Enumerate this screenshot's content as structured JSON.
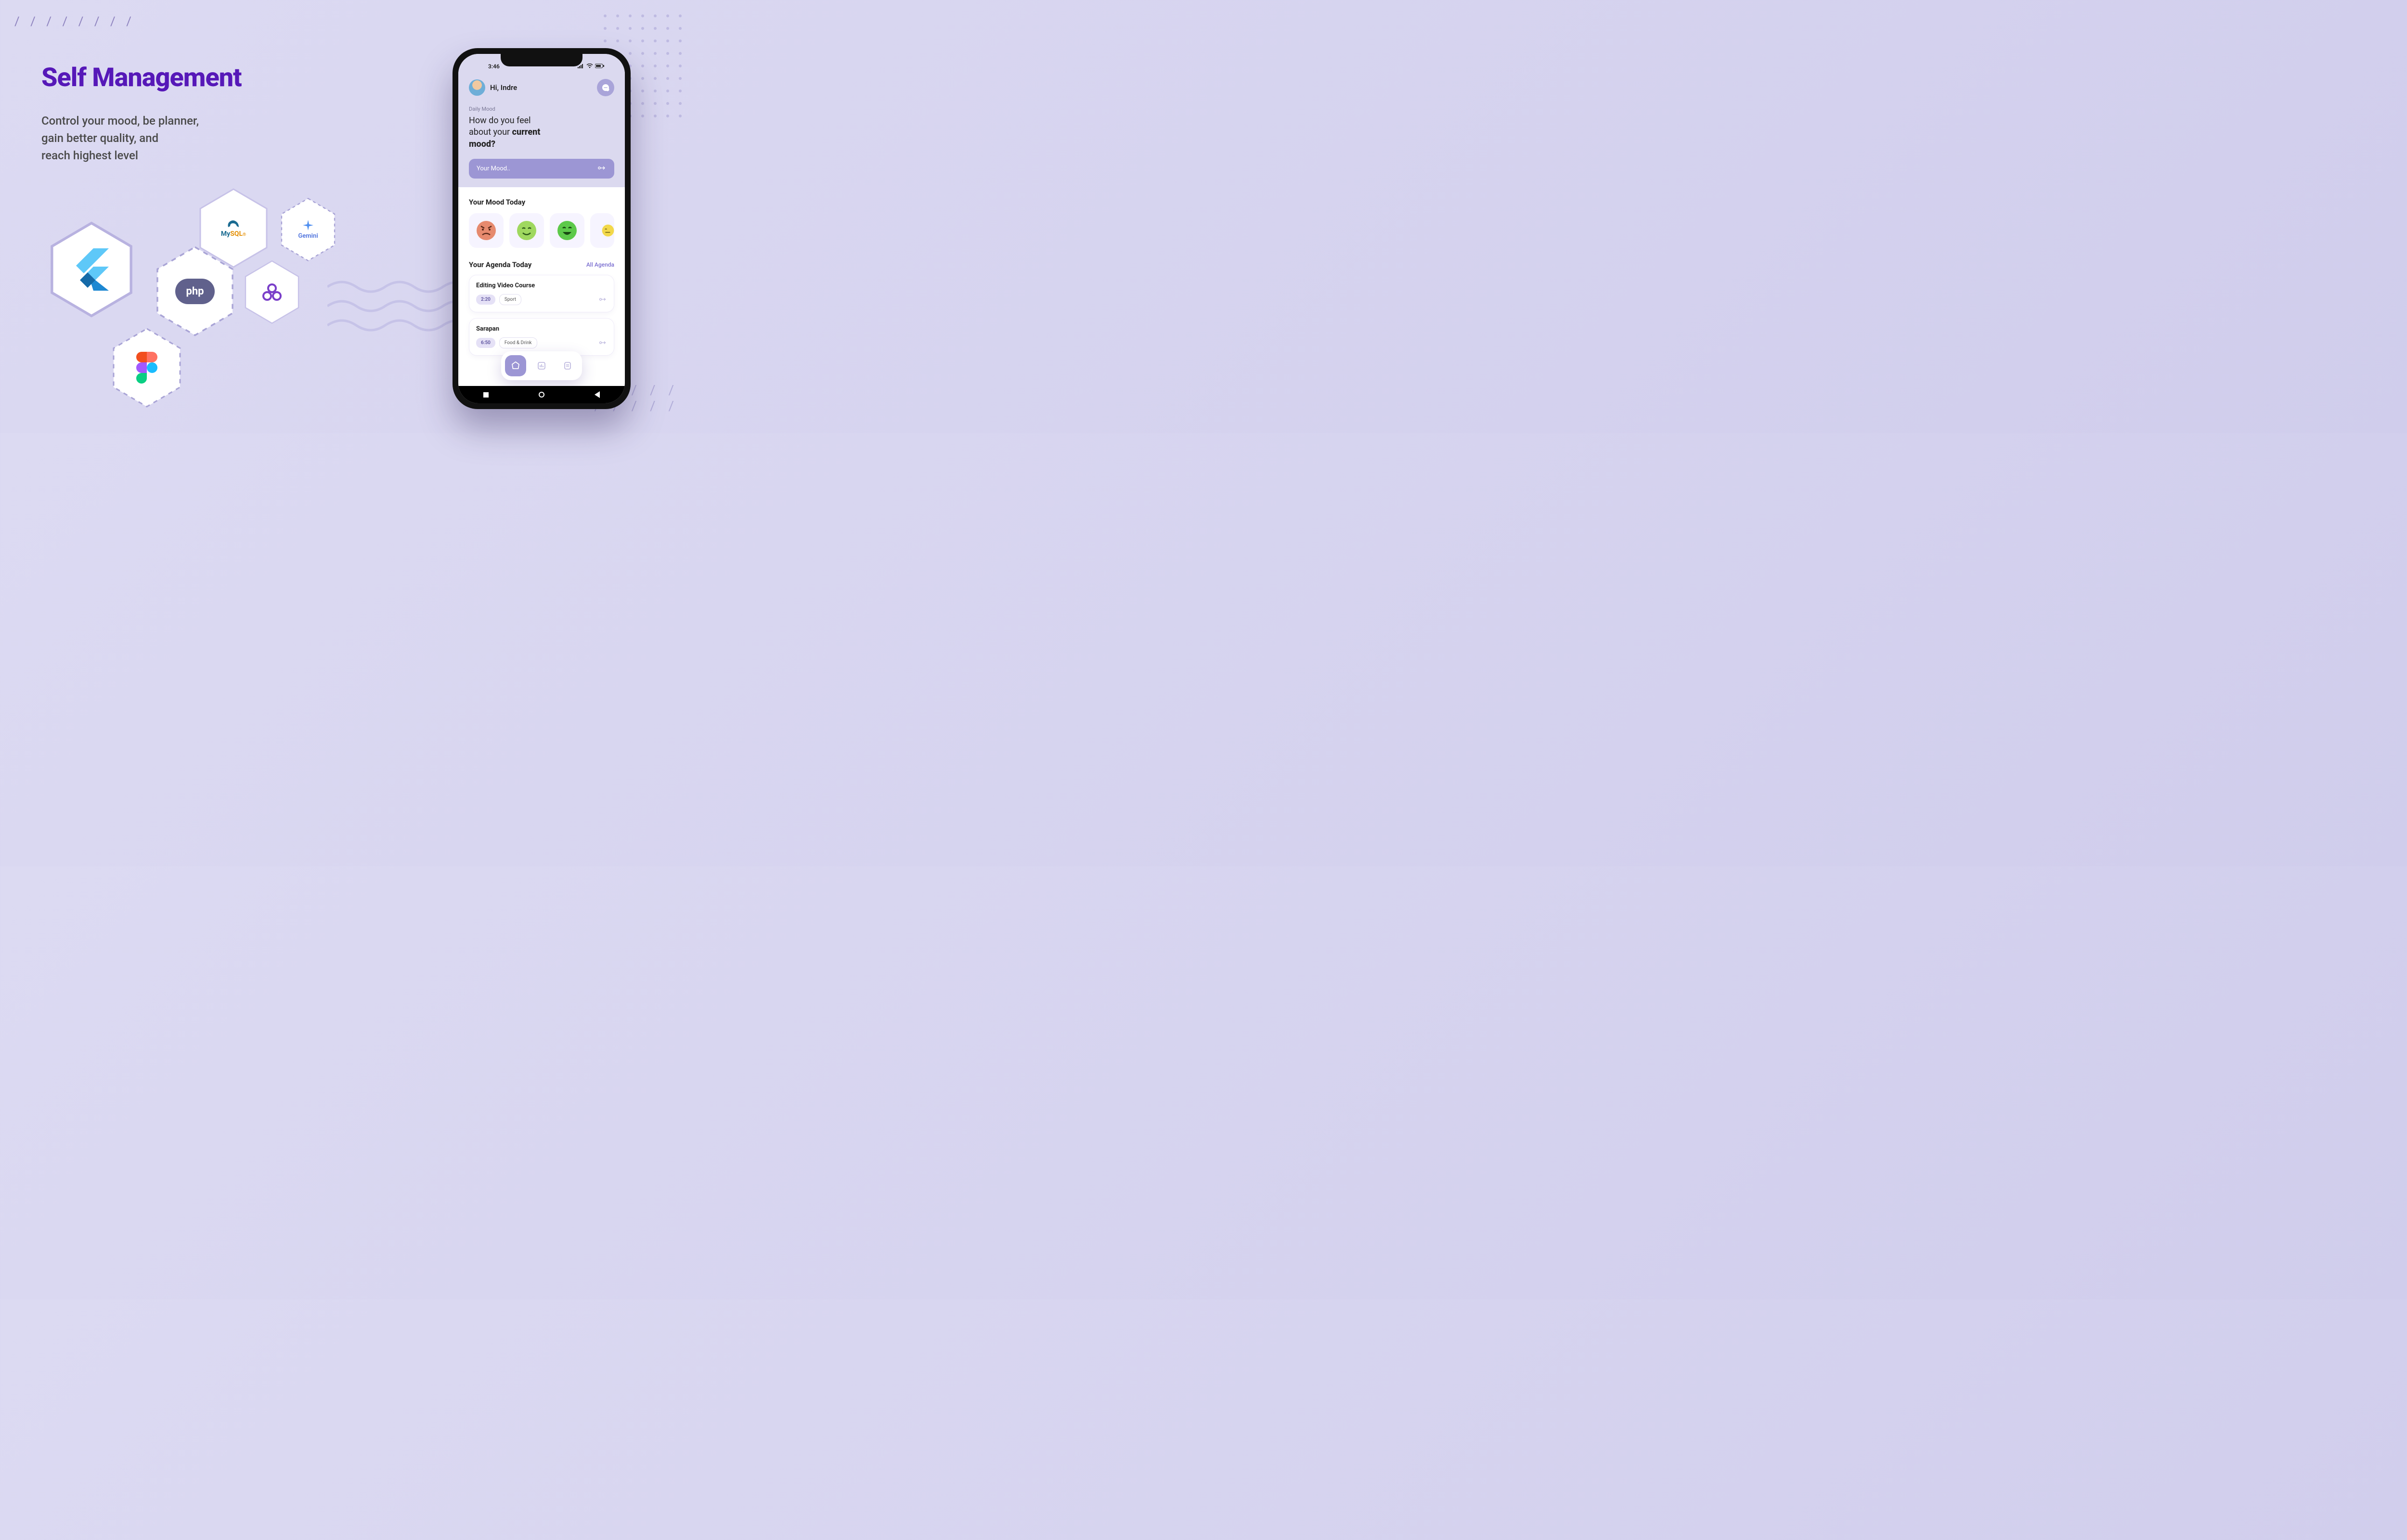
{
  "hero": {
    "title": "Self Management",
    "subtitle_l1": "Control your mood, be planner,",
    "subtitle_l2": "gain better quality, and",
    "subtitle_l3": "reach highest level"
  },
  "tech": {
    "mysql": "MySQL",
    "gemini": "Gemini",
    "php": "php",
    "flutter": "Flutter",
    "figma": "Figma",
    "asana": "Asana"
  },
  "phone": {
    "status_time": "3:46",
    "greeting": "Hi, Indre",
    "daily_label": "Daily Mood",
    "daily_q_l1": "How do you feel",
    "daily_q_l2_a": "about your ",
    "daily_q_l2_b": "current",
    "daily_q_l3": "mood?",
    "mood_placeholder": "Your Mood..",
    "mood_today_title": "Your Mood Today",
    "agenda_title": "Your Agenda Today",
    "all_agenda": "All Agenda",
    "agenda_items": [
      {
        "title": "Editing Video Course",
        "time": "2:20",
        "tag": "Sport"
      },
      {
        "title": "Sarapan",
        "time": "6:50",
        "tag": "Food & Drink"
      }
    ]
  }
}
